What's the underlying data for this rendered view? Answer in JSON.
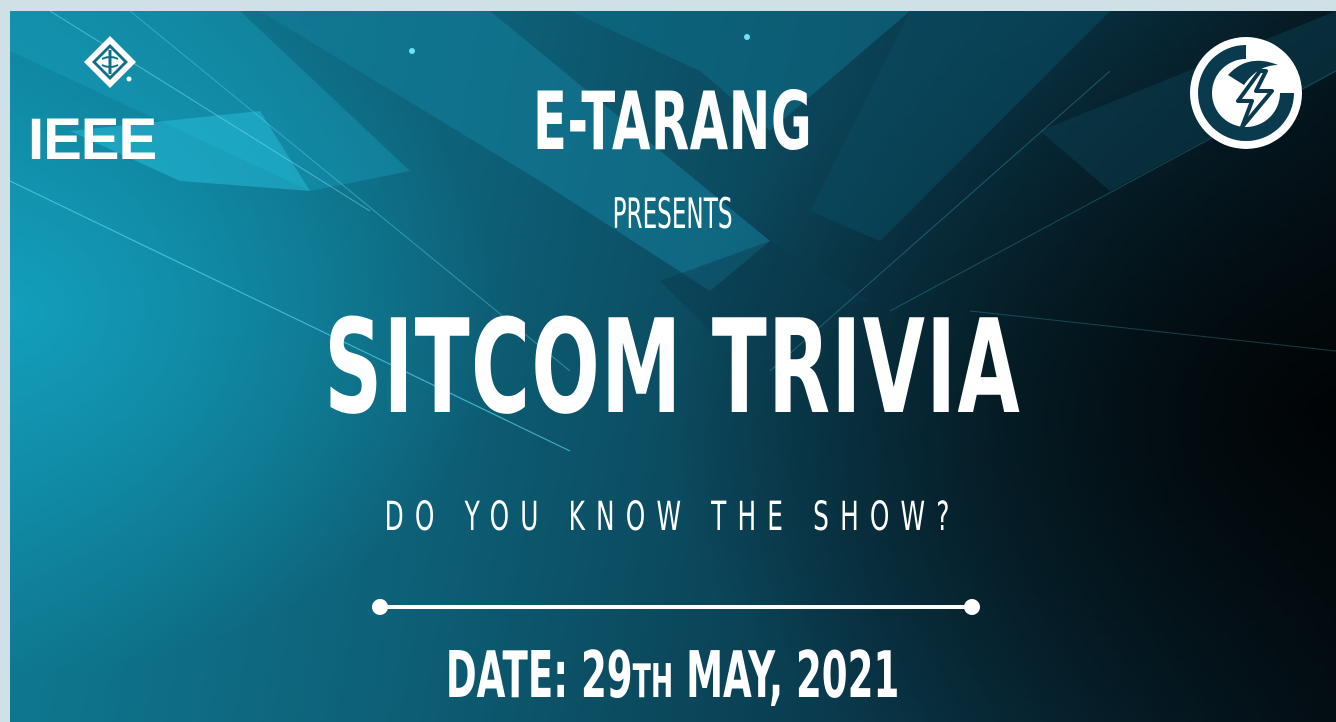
{
  "logos": {
    "left_text": "IEEE",
    "left_icon": "ieee-diamond-icon",
    "right_icon": "lightning-bolt-icon"
  },
  "poster": {
    "organizer": "E-TARANG",
    "presents": "PRESENTS",
    "title": "SITCOM TRIVIA",
    "tagline": "DO YOU KNOW THE SHOW?",
    "date_label": "DATE:",
    "date_day": "29",
    "date_suffix": "TH",
    "date_rest": "MAY, 2021"
  },
  "colors": {
    "accent": "#1fb6d6",
    "background_dark": "#04121a",
    "text": "#ffffff"
  }
}
